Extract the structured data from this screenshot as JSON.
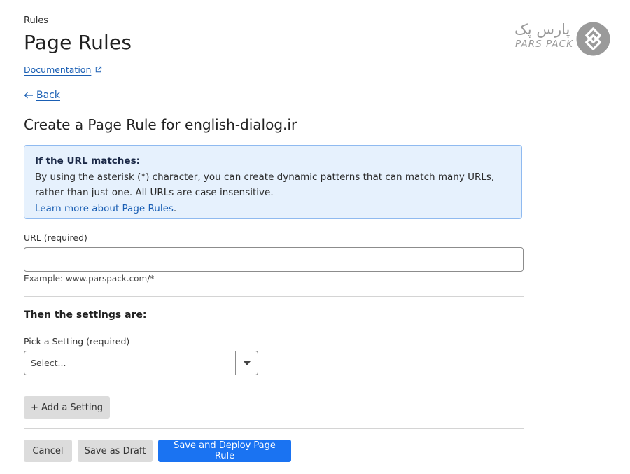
{
  "header": {
    "eyebrow": "Rules",
    "title": "Page Rules",
    "documentation_link": "Documentation",
    "back_link": "Back"
  },
  "brand": {
    "name_fa": "پارس پک",
    "name_en": "PARS PACK",
    "color": "#9a9a9a"
  },
  "form": {
    "heading": "Create a Page Rule for english-dialog.ir",
    "info": {
      "title": "If the URL matches:",
      "body": "By using the asterisk (*) character, you can create dynamic patterns that can match many URLs, rather than just one. All URLs are case insensitive.",
      "link": "Learn more about Page Rules",
      "link_suffix": "."
    },
    "url_field": {
      "label": "URL (required)",
      "value": "",
      "placeholder": "",
      "helper": "Example: www.parspack.com/*"
    },
    "settings": {
      "heading": "Then the settings are:",
      "pick_label": "Pick a Setting (required)",
      "selected": "Select...",
      "add_button": "+ Add a Setting"
    },
    "actions": {
      "cancel": "Cancel",
      "save_draft": "Save as Draft",
      "save_deploy": "Save and Deploy Page Rule"
    }
  },
  "colors": {
    "link": "#1a5fb4",
    "primary_button": "#1a73f2",
    "info_background": "#e6f1fd",
    "info_border": "#8fbaf0",
    "secondary_button": "#dcdcdc"
  }
}
